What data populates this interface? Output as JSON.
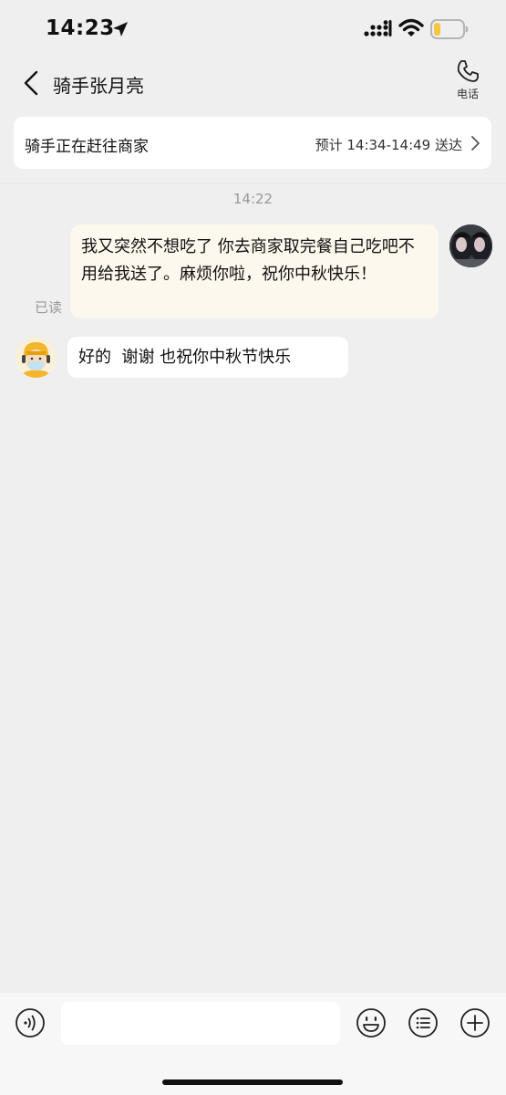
{
  "status_bar": {
    "time": "14:23",
    "battery_level": 0.2,
    "battery_color": "#f5c544"
  },
  "header": {
    "title": "骑手张月亮",
    "phone_label": "电话"
  },
  "status_card": {
    "title": "骑手正在赶往商家",
    "eta": "预计 14:34-14:49 送达"
  },
  "chat": {
    "timestamp": "14:22",
    "messages": [
      {
        "sender": "me",
        "text": "我又突然不想吃了 你去商家取完餐自己吃吧不用给我送了。麻烦你啦，祝你中秋快乐！",
        "status": "已读"
      },
      {
        "sender": "rider",
        "text": "好的  谢谢 也祝你中秋节快乐"
      }
    ]
  },
  "input_bar": {
    "placeholder": ""
  },
  "colors": {
    "background": "#efefef",
    "my_bubble": "#fdf8ed",
    "rider_bubble": "#ffffff"
  }
}
